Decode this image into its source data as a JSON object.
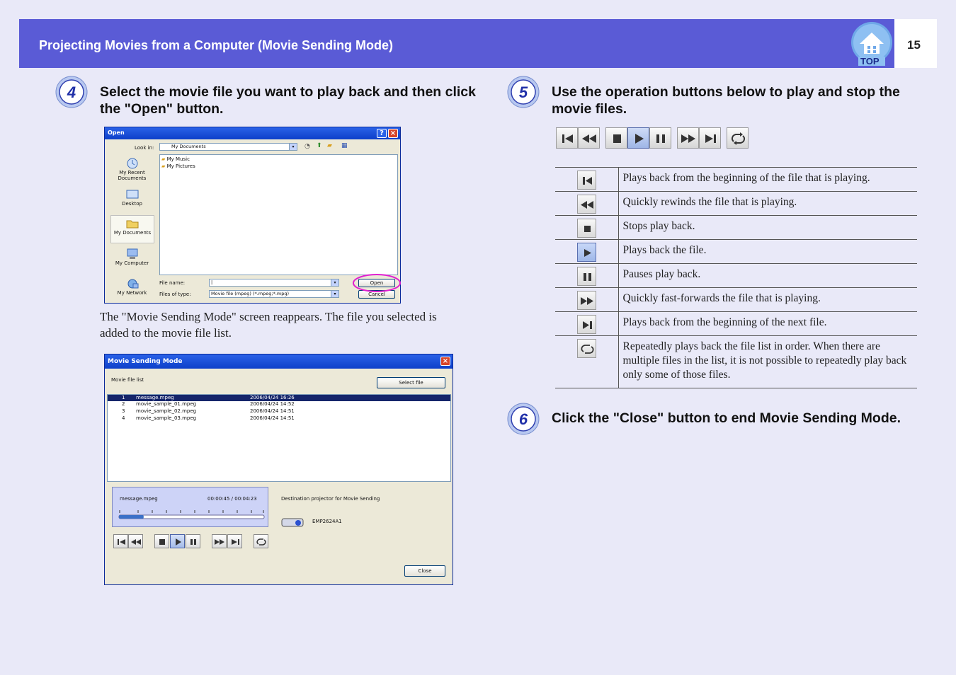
{
  "header": {
    "title": "Projecting Movies from a Computer (Movie Sending Mode)",
    "page_number": "15",
    "top_label": "TOP"
  },
  "steps": [
    {
      "num": "4",
      "text": "Select the movie file you want to play back and then click the \"Open\" button."
    },
    {
      "num": "5",
      "text": "Use the operation buttons below to play and stop the movie files."
    },
    {
      "num": "6",
      "text": "Click the \"Close\" button to end Movie Sending Mode."
    }
  ],
  "body_text": "The \"Movie Sending Mode\" screen reappears. The file you selected is added to the movie file list.",
  "open_dialog": {
    "title": "Open",
    "look_in_label": "Look in:",
    "look_in_value": "My Documents",
    "places": [
      "My Recent Documents",
      "Desktop",
      "My Documents",
      "My Computer",
      "My Network"
    ],
    "files": [
      "My Music",
      "My Pictures"
    ],
    "file_name_label": "File name:",
    "file_name_value": "|",
    "files_of_type_label": "Files of type:",
    "files_of_type_value": "Movie file (mpeg) (*.mpeg;*.mpg)",
    "open_label": "Open",
    "cancel_label": "Cancel"
  },
  "movie_dialog": {
    "title": "Movie Sending Mode",
    "list_label": "Movie file list",
    "select_file_label": "Select file",
    "rows": [
      {
        "num": "1",
        "name": "message.mpeg",
        "date": "2006/04/24 16:26"
      },
      {
        "num": "2",
        "name": "movie_sample_01.mpeg",
        "date": "2006/04/24 14:52"
      },
      {
        "num": "3",
        "name": "movie_sample_02.mpeg",
        "date": "2006/04/24 14:51"
      },
      {
        "num": "4",
        "name": "movie_sample_03.mpeg",
        "date": "2006/04/24 14:51"
      }
    ],
    "now_playing": "message.mpeg",
    "time": "00:00:45 / 00:04:23",
    "progress": 0.17,
    "destination_label": "Destination projector for Movie Sending",
    "projector_name": "EMP2624A1",
    "close_label": "Close"
  },
  "controls": [
    {
      "icon": "skip-to-start-icon",
      "text": "Plays back from the beginning of the file that is playing."
    },
    {
      "icon": "rewind-icon",
      "text": "Quickly rewinds the file that is playing."
    },
    {
      "icon": "stop-icon",
      "text": "Stops play back."
    },
    {
      "icon": "play-icon",
      "text": "Plays back the file."
    },
    {
      "icon": "pause-icon",
      "text": "Pauses play back."
    },
    {
      "icon": "fast-forward-icon",
      "text": "Quickly fast-forwards the file that is playing."
    },
    {
      "icon": "skip-to-next-icon",
      "text": "Plays back from the beginning of the next file."
    },
    {
      "icon": "repeat-icon",
      "text": "Repeatedly plays back the file list in order. When there are multiple files in the list, it is not possible to repeatedly play back only some of those files."
    }
  ],
  "colors": {
    "header": "#5a5bd6",
    "background": "#e9e9f8",
    "highlight_circle": "#e020d0"
  }
}
